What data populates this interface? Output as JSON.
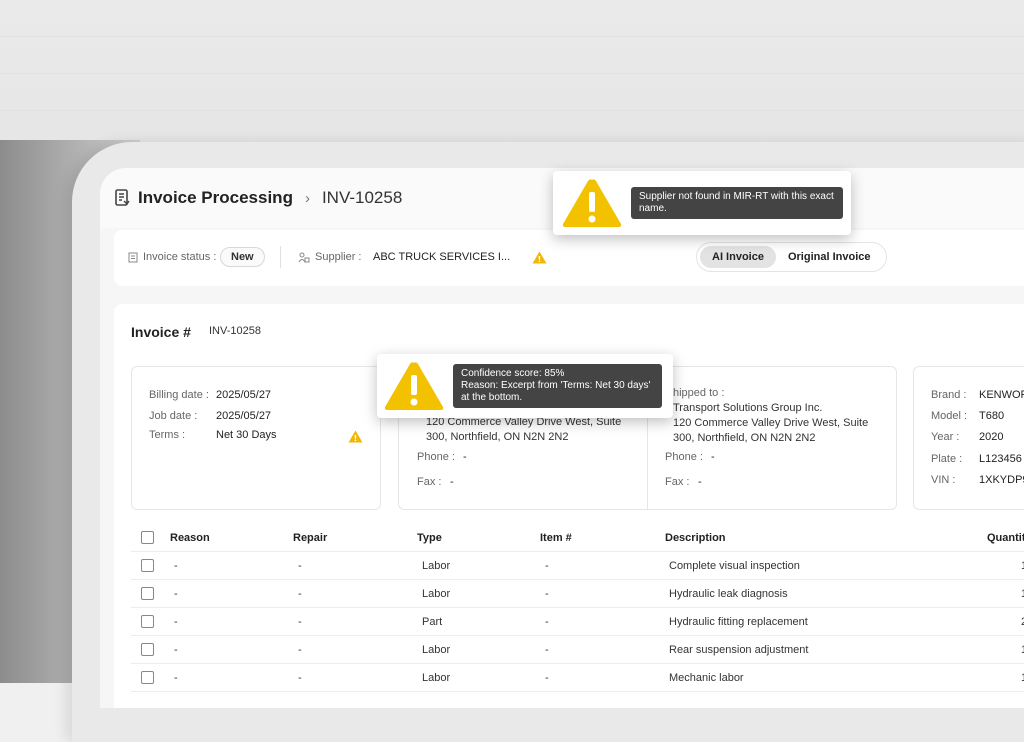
{
  "header": {
    "app_title": "Invoice Processing",
    "breadcrumb_sep": "›",
    "invoice_id": "INV-10258"
  },
  "status_bar": {
    "status_label": "Invoice status :",
    "status_value": "New",
    "supplier_label": "Supplier :",
    "supplier_value": "ABC TRUCK SERVICES I...",
    "toggle": [
      "AI Invoice",
      "Original Invoice"
    ]
  },
  "tooltips": {
    "supplier": "Supplier not found in MIR-RT with this exact name.",
    "confidence_line1": "Confidence score: 85%",
    "confidence_line2": "Reason: Excerpt from 'Terms: Net 30 days'",
    "confidence_line3": "at the bottom."
  },
  "invoice": {
    "label": "Invoice #",
    "number": "INV-10258",
    "billing_date_label": "Billing date :",
    "billing_date": "2025/05/27",
    "job_date_label": "Job date :",
    "job_date": "2025/05/27",
    "terms_label": "Terms :",
    "terms": "Net 30 Days"
  },
  "bill_to": {
    "addr1": "120 Commerce Valley Drive West, Suite",
    "addr2": "300, Northfield, ON N2N 2N2",
    "phone_label": "Phone :",
    "phone": "-",
    "fax_label": "Fax :",
    "fax": "-"
  },
  "ship_to": {
    "label": "hipped to :",
    "name": "Transport Solutions Group Inc.",
    "addr1": "120 Commerce Valley Drive West, Suite",
    "addr2": "300, Northfield, ON N2N 2N2",
    "phone_label": "Phone :",
    "phone": "-",
    "fax_label": "Fax :",
    "fax": "-"
  },
  "vehicle": {
    "brand_label": "Brand :",
    "brand": "KENWOR",
    "model_label": "Model :",
    "model": "T680",
    "year_label": "Year :",
    "year": "2020",
    "plate_label": "Plate :",
    "plate": "L123456",
    "vin_label": "VIN :",
    "vin": "1XKYDP9"
  },
  "table": {
    "headers": [
      "Reason",
      "Repair",
      "Type",
      "Item #",
      "Description",
      "Quantit"
    ],
    "rows": [
      {
        "reason": "-",
        "repair": "-",
        "type": "Labor",
        "item": "-",
        "description": "Complete visual inspection",
        "qty": "1"
      },
      {
        "reason": "-",
        "repair": "-",
        "type": "Labor",
        "item": "-",
        "description": "Hydraulic leak diagnosis",
        "qty": "1"
      },
      {
        "reason": "-",
        "repair": "-",
        "type": "Part",
        "item": "-",
        "description": "Hydraulic fitting replacement",
        "qty": "2"
      },
      {
        "reason": "-",
        "repair": "-",
        "type": "Labor",
        "item": "-",
        "description": "Rear suspension adjustment",
        "qty": "1"
      },
      {
        "reason": "-",
        "repair": "-",
        "type": "Labor",
        "item": "-",
        "description": "Mechanic labor",
        "qty": "1"
      }
    ]
  },
  "colors": {
    "warning": "#f2c200",
    "tooltip_bg": "#444444"
  }
}
